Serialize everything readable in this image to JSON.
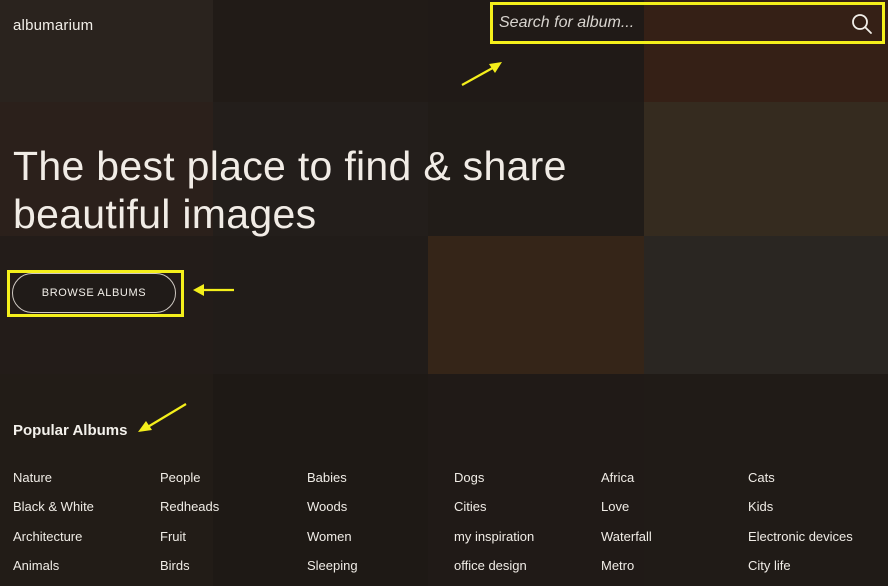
{
  "header": {
    "logo": "albumarium",
    "search_placeholder": "Search for album..."
  },
  "hero": {
    "title_line1": "The best place to find & share",
    "title_line2": "beautiful images",
    "browse_label": "BROWSE ALBUMS"
  },
  "popular": {
    "title": "Popular Albums",
    "albums": [
      "Nature",
      "People",
      "Babies",
      "Dogs",
      "Africa",
      "Cats",
      "Black & White",
      "Redheads",
      "Woods",
      "Cities",
      "Love",
      "Kids",
      "Architecture",
      "Fruit",
      "Women",
      "my inspiration",
      "Waterfall",
      "Electronic devices",
      "Animals",
      "Birds",
      "Sleeping",
      "office design",
      "Metro",
      "City life"
    ]
  },
  "colors": {
    "highlight": "#f4ef1b",
    "background": "#1c1714",
    "text": "#f0ece6"
  },
  "mosaic_tiles": [
    "#3a302a",
    "#2b2420",
    "#2a231f",
    "#4a2c1e",
    "#3b2c25",
    "#2e2925",
    "#2b2521",
    "#4a3d2b",
    "#2e2622",
    "#2b2522",
    "#4a3321",
    "#3a3530",
    "#2d2520",
    "#27211d",
    "#2a2320",
    "#2a2420"
  ]
}
